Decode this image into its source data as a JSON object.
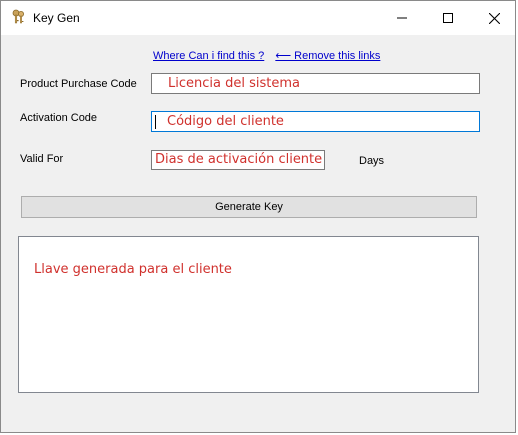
{
  "window": {
    "title": "Key Gen",
    "icon": "keys-icon",
    "controls": {
      "minimize": "minimize-icon",
      "maximize": "maximize-icon",
      "close": "close-icon"
    }
  },
  "links": {
    "where": "Where Can i find this ?",
    "remove": "⟵ Remove this links"
  },
  "form": {
    "purchase_label": "Product Purchase Code",
    "purchase_value": "Licencia del sistema",
    "activation_label": "Activation Code",
    "activation_value": "Código del cliente",
    "valid_label": "Valid For",
    "valid_value": "Dias de activación cliente",
    "valid_unit": "Days"
  },
  "generate_button": "Generate Key",
  "output_value": "Llave generada para el cliente",
  "colors": {
    "annotation_text": "#d0312d",
    "link": "#0000cc",
    "focus_border": "#0078d7"
  }
}
